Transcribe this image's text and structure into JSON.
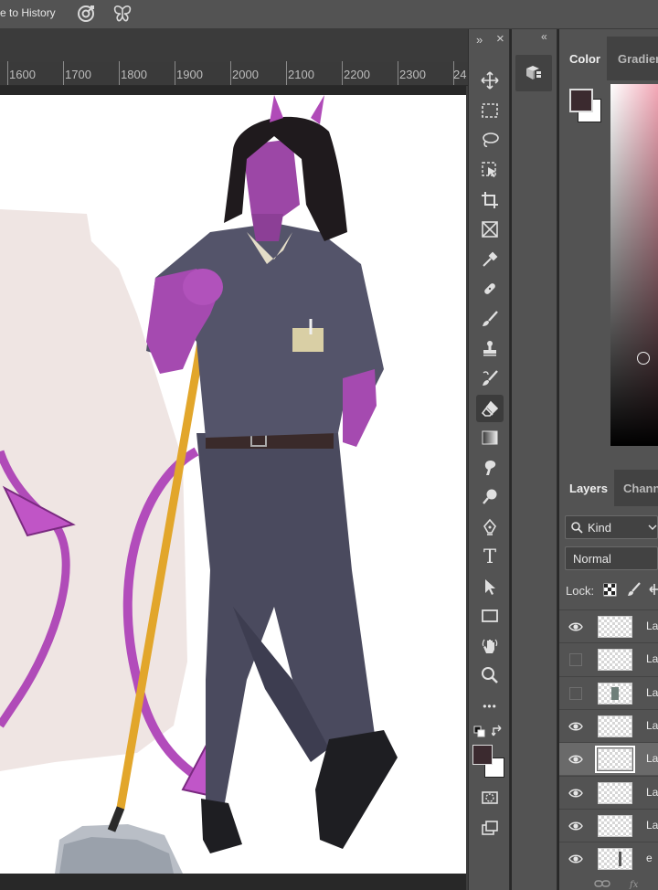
{
  "options_bar": {
    "history_label": "e to History"
  },
  "ruler": {
    "labels": [
      "1600",
      "1700",
      "1800",
      "1900",
      "2000",
      "2100",
      "2200",
      "2300",
      "24"
    ]
  },
  "toolbar": {
    "collapse_icon": "»",
    "close_icon": "×",
    "tools": [
      "move",
      "marquee",
      "lasso",
      "object-select",
      "crop",
      "frame",
      "eyedropper",
      "healing",
      "brush",
      "stamp",
      "history-brush",
      "eraser",
      "gradient",
      "smudge",
      "dodge",
      "pen",
      "type",
      "path-select",
      "rectangle",
      "hand",
      "zoom",
      "more"
    ],
    "active_tool": "eraser",
    "type_glyph": "T",
    "more_glyph": "•••"
  },
  "strip": {
    "collapse_icon": "«"
  },
  "colors": {
    "foreground": "#3b2a2f",
    "background": "#ffffff",
    "accent_pink": "#f4a8b7"
  },
  "color_panel": {
    "tabs": [
      "Color",
      "Gradien"
    ]
  },
  "layers_panel": {
    "tabs": [
      "Layers",
      "Chann"
    ],
    "filter_label": "Kind",
    "blend_mode": "Normal",
    "lock_label": "Lock:",
    "layers": [
      {
        "name": "La",
        "visible": true,
        "selected": false
      },
      {
        "name": "La",
        "visible": false,
        "selected": false
      },
      {
        "name": "La",
        "visible": false,
        "selected": false
      },
      {
        "name": "La",
        "visible": true,
        "selected": false
      },
      {
        "name": "La",
        "visible": true,
        "selected": true
      },
      {
        "name": "La",
        "visible": true,
        "selected": false
      },
      {
        "name": "La",
        "visible": true,
        "selected": false
      },
      {
        "name": "e",
        "visible": true,
        "selected": false
      }
    ]
  }
}
